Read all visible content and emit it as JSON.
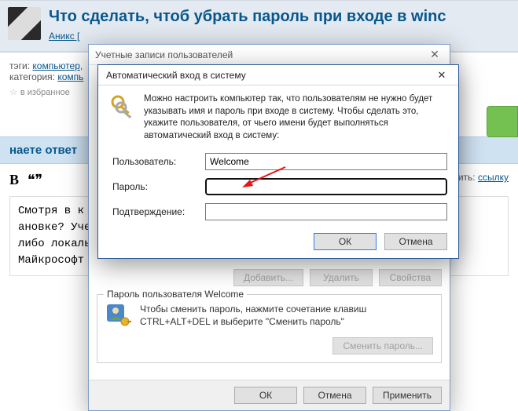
{
  "page": {
    "question_title": "Что сделать, чтоб убрать пароль при входе в winс",
    "author": "Аникс [",
    "tags_label": "тэги:",
    "tags": [
      "компьютер"
    ],
    "category_label": "категория:",
    "category": "компь",
    "favorite_label": "в избранное",
    "answer_stripe": "наете ответ",
    "editor": {
      "bold": "B",
      "quote": "❝❞"
    },
    "add_label": "добавить:",
    "add_link": "ссылку",
    "answer_visible": {
      "line1_prefix": "Смотря в к",
      "line1_suffix": "ановке? Учетна",
      "line2": "либо локаль",
      "line3": "Майкрософт"
    }
  },
  "outer": {
    "title": "Учетные записи пользователей",
    "mid_buttons": {
      "add": "Добавить...",
      "remove": "Удалить",
      "props": "Свойства"
    },
    "group_title": "Пароль пользователя Welcome",
    "group_text": "Чтобы сменить пароль, нажмите сочетание клавиш CTRL+ALT+DEL и выберите \"Сменить пароль\"",
    "group_button": "Сменить пароль...",
    "footer": {
      "ok": "ОК",
      "cancel": "Отмена",
      "apply": "Применить"
    }
  },
  "inner": {
    "title": "Автоматический вход в систему",
    "intro": "Можно настроить компьютер так, что пользователям не нужно будет указывать имя и пароль при входе в систему. Чтобы сделать это, укажите пользователя, от чьего имени будет выполняться автоматический вход в систему:",
    "labels": {
      "user": "Пользователь:",
      "password": "Пароль:",
      "confirm": "Подтверждение:"
    },
    "values": {
      "user": "Welcome",
      "password": "",
      "confirm": ""
    },
    "footer": {
      "ok": "ОК",
      "cancel": "Отмена"
    }
  }
}
